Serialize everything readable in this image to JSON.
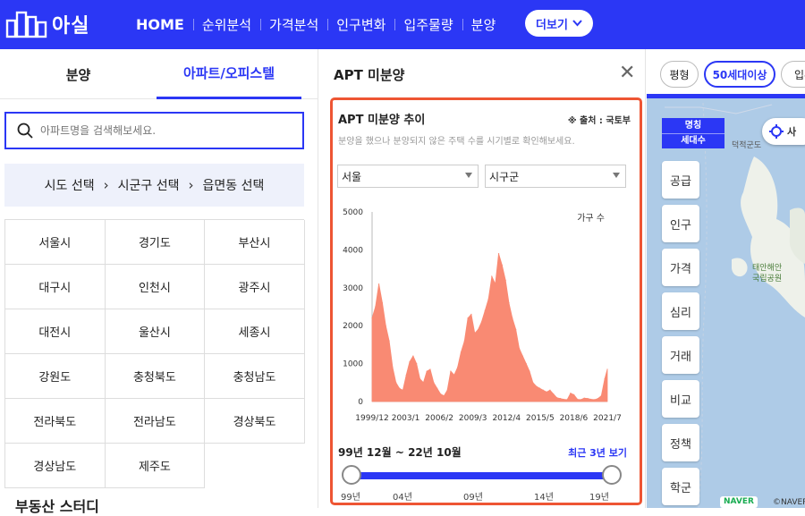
{
  "header": {
    "logo_text": "아실",
    "nav": [
      "HOME",
      "순위분석",
      "가격분석",
      "인구변화",
      "입주물량",
      "분양"
    ],
    "more_label": "더보기"
  },
  "left": {
    "tabs": [
      "분양",
      "아파트/오피스텔"
    ],
    "search_placeholder": "아파트명을 검색해보세요.",
    "region_steps": [
      "시도 선택",
      "시군구 선택",
      "읍면동 선택"
    ],
    "regions": [
      "서울시",
      "경기도",
      "부산시",
      "대구시",
      "인천시",
      "광주시",
      "대전시",
      "울산시",
      "세종시",
      "강원도",
      "충청북도",
      "충청남도",
      "전라북도",
      "전라남도",
      "경상북도",
      "경상남도",
      "제주도"
    ],
    "bottom_heading": "부동산 스터디"
  },
  "panel": {
    "title": "APT 미분양",
    "card_title": "APT 미분양 추이",
    "source": "※ 출처 : 국토부",
    "description": "분양을 했으나 분양되지 않은 주택 수를 시기별로 확인해보세요.",
    "select_region": "서울",
    "select_district": "시구군",
    "range_text": "99년 12월 ~ 22년 10월",
    "recent_link": "최근 3년 보기",
    "slider_labels": [
      "99년",
      "04년",
      "09년",
      "14년",
      "19년"
    ],
    "slider_range": [
      0,
      1
    ]
  },
  "chart_data": {
    "type": "area",
    "legend": "가구 수",
    "ylim": [
      0,
      5000
    ],
    "yticks": [
      0,
      1000,
      2000,
      3000,
      4000,
      5000
    ],
    "xtick_labels": [
      "1999/12",
      "2003/1",
      "2006/2",
      "2009/3",
      "2012/4",
      "2015/5",
      "2018/6",
      "2021/7"
    ],
    "x_start": "1999/12",
    "x_end": "2022/10",
    "color": "#f98a73",
    "x": [
      1999.92,
      2000.25,
      2000.58,
      2000.92,
      2001.25,
      2001.58,
      2001.92,
      2002.25,
      2002.58,
      2002.92,
      2003.25,
      2003.58,
      2003.92,
      2004.25,
      2004.58,
      2004.92,
      2005.25,
      2005.58,
      2005.92,
      2006.25,
      2006.58,
      2006.92,
      2007.25,
      2007.58,
      2007.92,
      2008.25,
      2008.58,
      2008.92,
      2009.25,
      2009.58,
      2009.92,
      2010.25,
      2010.58,
      2010.92,
      2011.25,
      2011.58,
      2011.92,
      2012.25,
      2012.58,
      2012.92,
      2013.25,
      2013.58,
      2013.92,
      2014.25,
      2014.58,
      2014.92,
      2015.25,
      2015.58,
      2015.92,
      2016.25,
      2016.58,
      2016.92,
      2017.25,
      2017.58,
      2017.92,
      2018.25,
      2018.58,
      2018.92,
      2019.25,
      2019.58,
      2019.92,
      2020.25,
      2020.58,
      2020.92,
      2021.25,
      2021.58,
      2021.92,
      2022.25,
      2022.58,
      2022.83
    ],
    "values": [
      2200,
      2500,
      3100,
      2600,
      2000,
      1600,
      900,
      500,
      350,
      300,
      700,
      1050,
      1200,
      1000,
      600,
      500,
      800,
      850,
      500,
      350,
      200,
      150,
      300,
      800,
      700,
      900,
      1300,
      1600,
      2200,
      2300,
      1800,
      1900,
      2100,
      2400,
      2700,
      3300,
      3100,
      3900,
      3600,
      3200,
      2600,
      2200,
      1900,
      1400,
      1200,
      1000,
      800,
      500,
      400,
      350,
      300,
      250,
      300,
      200,
      100,
      80,
      60,
      50,
      220,
      180,
      60,
      50,
      90,
      80,
      60,
      50,
      80,
      150,
      600,
      850
    ]
  },
  "map": {
    "chips": [
      "평형",
      "50세대이상",
      "입주"
    ],
    "legend_title": "명칭",
    "legend_sub": "세대수",
    "buttons": [
      "공급",
      "인구",
      "가격",
      "심리",
      "거래",
      "비교",
      "정책",
      "학군"
    ],
    "location_label": "사",
    "labels": [
      "덕적군도",
      "태안해안",
      "국립공원"
    ],
    "naver": "NAVER",
    "naver_copy": "©NAVER"
  }
}
